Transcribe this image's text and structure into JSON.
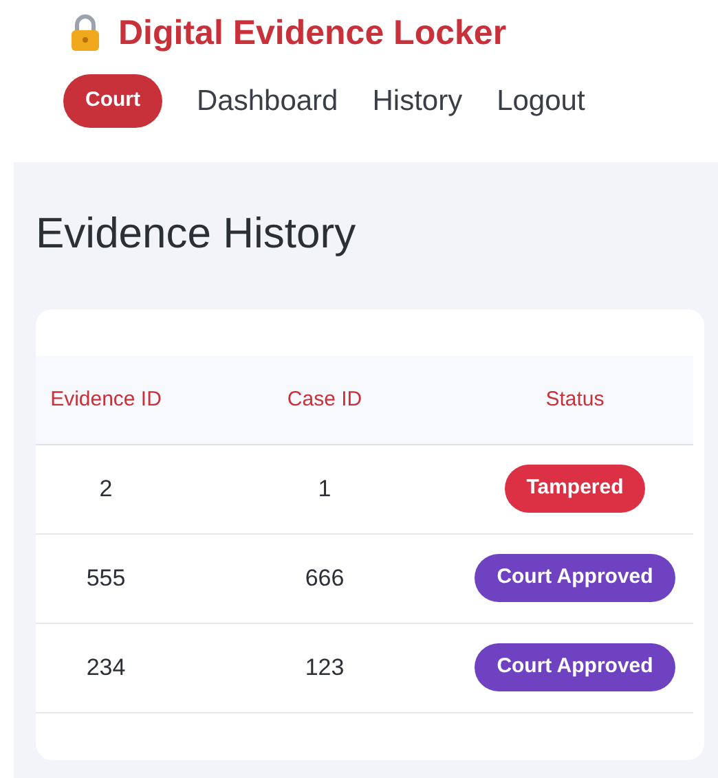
{
  "header": {
    "title": "Digital Evidence Locker",
    "role_badge": "Court",
    "nav": [
      "Dashboard",
      "History",
      "Logout"
    ]
  },
  "page_title": "Evidence History",
  "table": {
    "columns": [
      "Evidence ID",
      "Case ID",
      "Status"
    ],
    "rows": [
      {
        "evidence_id": "2",
        "case_id": "1",
        "status": {
          "label": "Tampered",
          "kind": "tampered"
        }
      },
      {
        "evidence_id": "555",
        "case_id": "666",
        "status": {
          "label": "Court Approved",
          "kind": "approved"
        }
      },
      {
        "evidence_id": "234",
        "case_id": "123",
        "status": {
          "label": "Court Approved",
          "kind": "approved"
        }
      }
    ]
  }
}
